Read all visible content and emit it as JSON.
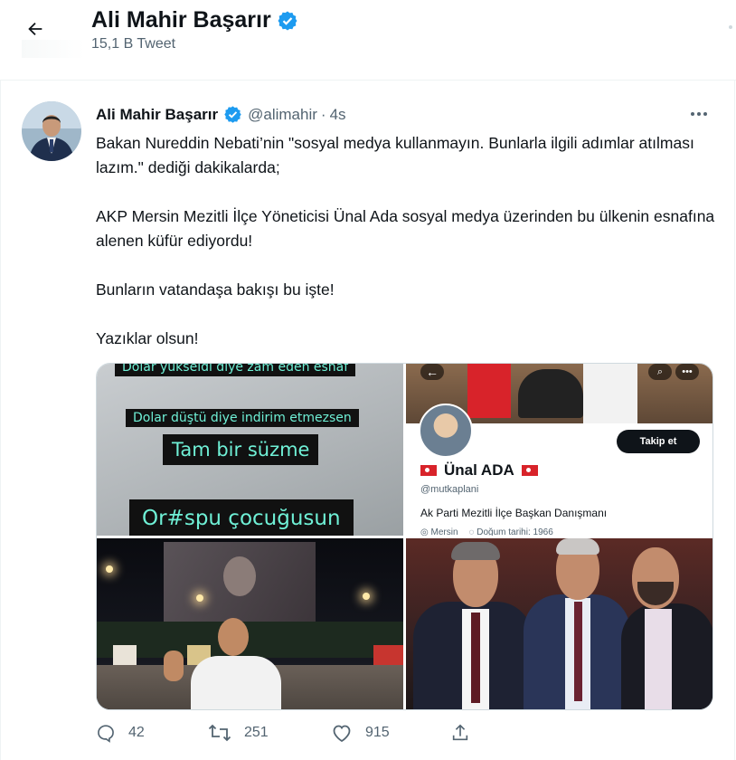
{
  "header": {
    "title": "Ali Mahir Başarır",
    "subtitle": "15,1 B Tweet"
  },
  "tweet": {
    "name": "Ali Mahir Başarır",
    "handle": "@alimahir",
    "separator": "·",
    "time": "4s",
    "text": "Bakan Nureddin Nebati’nin \"sosyal medya kullanmayın. Bunlarla ilgili adımlar atılması lazım.\" dediği dakikalarda;\n\nAKP Mersin Mezitli İlçe Yöneticisi Ünal Ada sosyal medya üzerinden bu ülkenin esnafına alenen küfür ediyordu!\n\nBunların vatandaşa bakışı bu işte!\n\nYazıklar olsun!"
  },
  "media": {
    "image1": {
      "captions": [
        "Dolar yükseldi diye zam eden esnaf",
        "Dolar düştü diye indirim etmezsen",
        "Tam bir süzme",
        "Or#spu çocuğusun"
      ]
    },
    "image2": {
      "follow_label": "Takip et",
      "profile_name": "Ünal ADA",
      "profile_handle": "@mutkaplani",
      "bio": "Ak Parti Mezitli İlçe Başkan Danışmanı",
      "location": "Mersin",
      "birth": "Doğum tarihi: 1966"
    }
  },
  "actions": {
    "replies": "42",
    "retweets": "251",
    "likes": "915"
  },
  "colors": {
    "verified": "#1d9bf0",
    "muted": "#536471",
    "caption": "#6ff0d6"
  }
}
